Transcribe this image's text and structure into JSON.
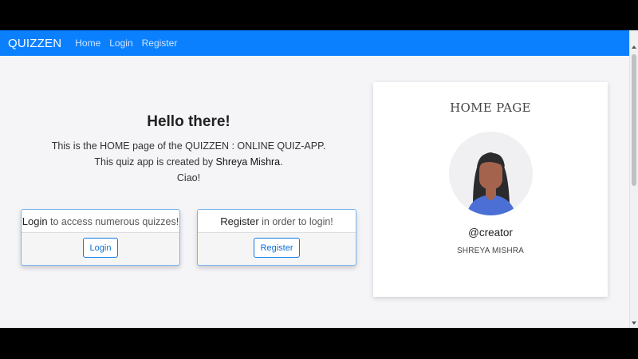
{
  "navbar": {
    "brand": "QUIZZEN",
    "links": [
      "Home",
      "Login",
      "Register"
    ]
  },
  "hero": {
    "title": "Hello there!",
    "line1": "This is the HOME page of the QUIZZEN : ONLINE QUIZ-APP.",
    "line2_prefix": "This quiz app is created by ",
    "line2_name": "Shreya Mishra",
    "line2_suffix": ".",
    "line3": "Ciao!"
  },
  "login_card": {
    "bold": "Login",
    "text": " to access numerous quizzes!",
    "button": "Login"
  },
  "register_card": {
    "bold": "Register",
    "text": " in order to login!",
    "button": "Register"
  },
  "profile": {
    "title": "HOME PAGE",
    "handle": "@creator",
    "name": "SHREYA MISHRA",
    "avatar_icon": "woman-avatar-icon"
  },
  "colors": {
    "navbar": "#0b80ff",
    "accent": "#0b7ae8",
    "avatar_hair": "#2b2b2e",
    "avatar_skin": "#a4634d",
    "avatar_shirt": "#4c6fd6"
  }
}
